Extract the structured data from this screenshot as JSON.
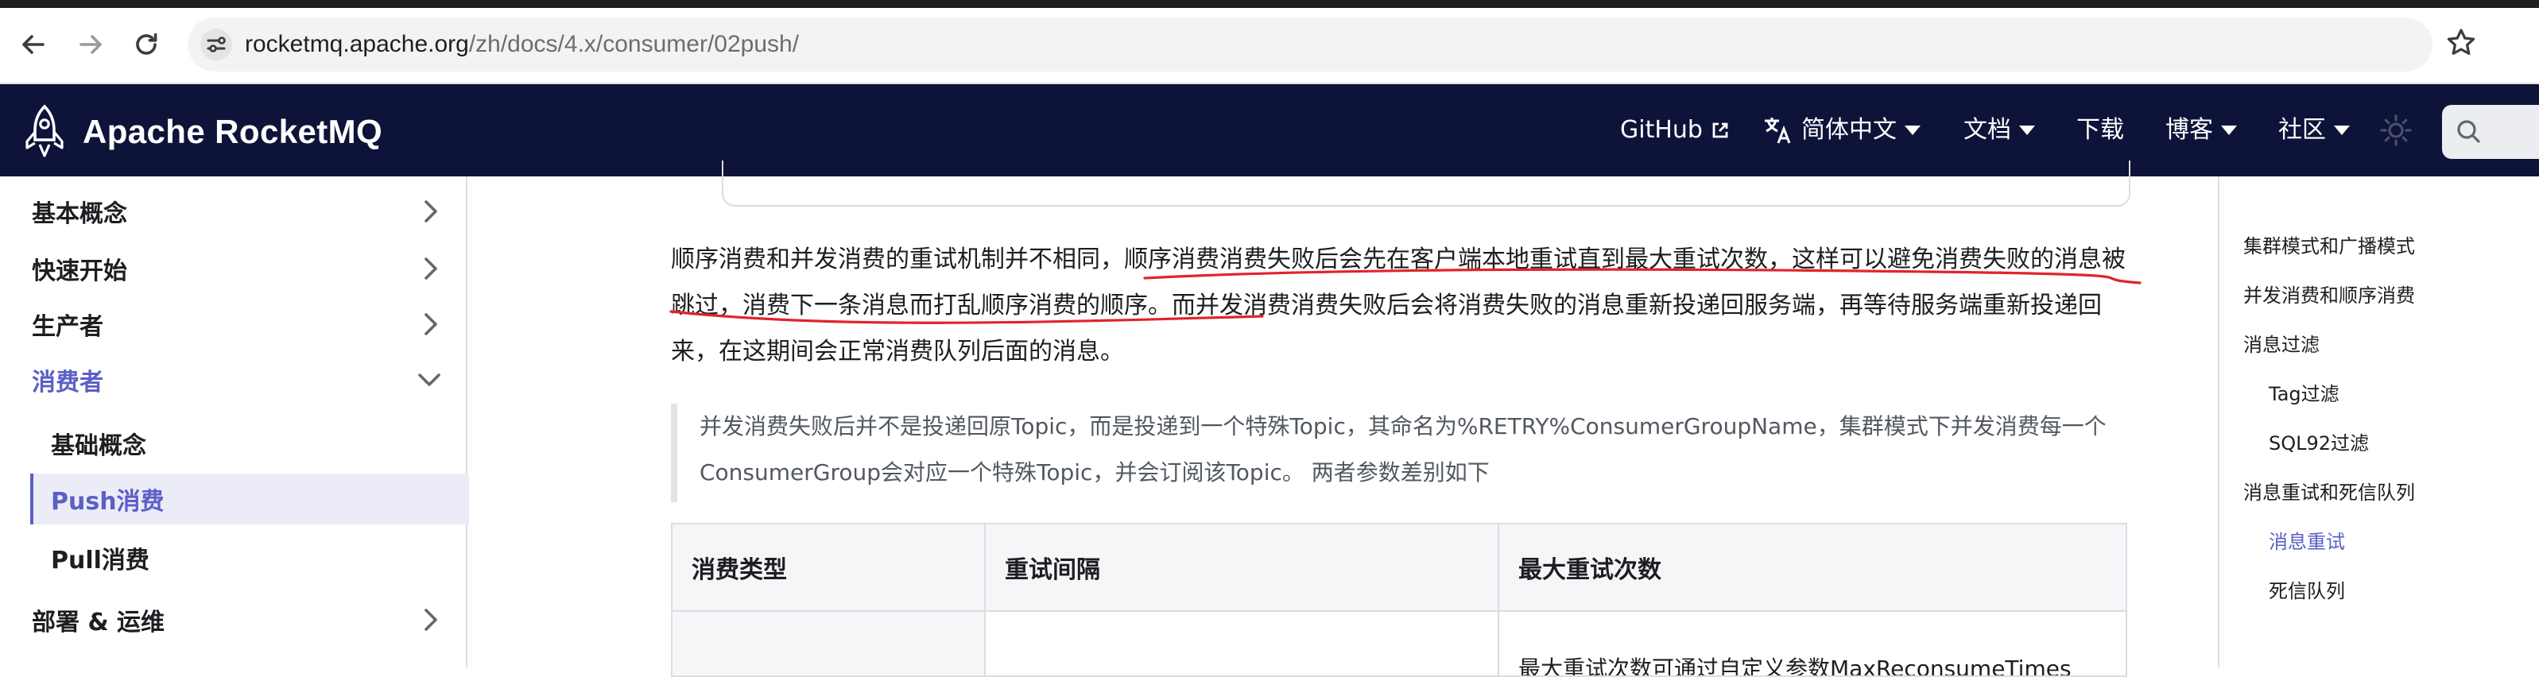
{
  "browser": {
    "url_host": "rocketmq.apache.org",
    "url_path": "/zh/docs/4.x/consumer/02push/"
  },
  "navbar": {
    "brand": "Apache RocketMQ",
    "items": [
      {
        "label": "GitHub"
      },
      {
        "label": "简体中文"
      },
      {
        "label": "文档"
      },
      {
        "label": "下载"
      },
      {
        "label": "博客"
      },
      {
        "label": "社区"
      }
    ]
  },
  "sidebar": {
    "items": [
      {
        "label": "基本概念"
      },
      {
        "label": "快速开始"
      },
      {
        "label": "生产者"
      },
      {
        "label": "消费者"
      },
      {
        "label": "基础概念"
      },
      {
        "label": "Push消费"
      },
      {
        "label": "Pull消费"
      },
      {
        "label": "部署 & 运维"
      }
    ]
  },
  "content": {
    "para_before": "顺序消费和并发消费的重试机制并不相同，",
    "para_highlight": "顺序消费消费失败后会先在客户端本地重试直到最大重试次数，这样可以避免消费失败的消息被跳过，消费下一条消息而打乱顺序消费的顺序。",
    "para_after": "而并发消费消费失败后会将消费失败的消息重新投递回服务端，再等待服务端重新投递回来，在这期间会正常消费队列后面的消息。",
    "quote": "并发消费失败后并不是投递回原Topic，而是投递到一个特殊Topic，其命名为%RETRY%ConsumerGroupName，集群模式下并发消费每一个ConsumerGroup会对应一个特殊Topic，并会订阅该Topic。 两者参数差别如下",
    "table": {
      "headers": [
        "消费类型",
        "重试间隔",
        "最大重试次数"
      ],
      "row1_cell3": "最大重试次数可通过自定义参数MaxReconsumeTimes"
    }
  },
  "toc": {
    "items": [
      {
        "label": "集群模式和广播模式"
      },
      {
        "label": "并发消费和顺序消费"
      },
      {
        "label": "消息过滤"
      },
      {
        "label": "Tag过滤"
      },
      {
        "label": "SQL92过滤"
      },
      {
        "label": "消息重试和死信队列"
      },
      {
        "label": "消息重试"
      },
      {
        "label": "死信队列"
      }
    ]
  },
  "colors": {
    "navbar_bg": "#0e1339",
    "accent": "#5b5fc7",
    "annotation_red": "#e0242b"
  }
}
